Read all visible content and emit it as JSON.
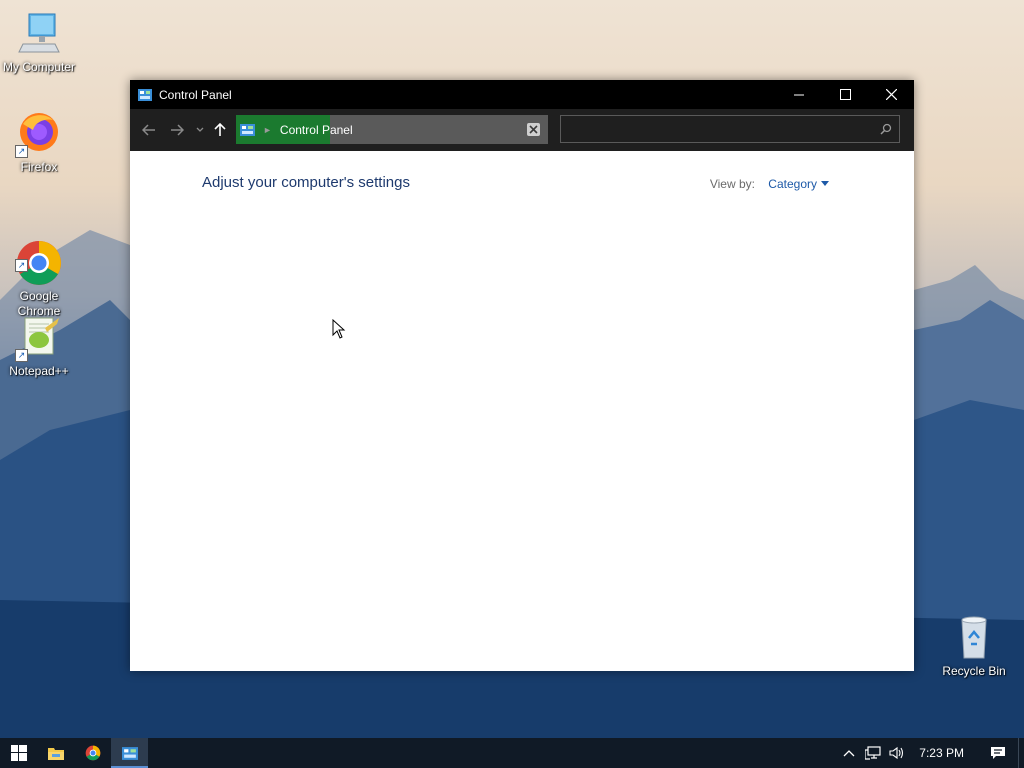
{
  "desktop": {
    "icons": [
      {
        "label": "My Computer",
        "icon": "computer-icon"
      },
      {
        "label": "Firefox",
        "icon": "firefox-icon"
      },
      {
        "label": "Google\nChrome",
        "icon": "chrome-icon"
      },
      {
        "label": "Notepad++",
        "icon": "notepadpp-icon"
      },
      {
        "label": "Recycle Bin",
        "icon": "recycle-bin-icon"
      }
    ]
  },
  "window": {
    "title": "Control Panel",
    "address": {
      "crumb": "Control Panel",
      "search_placeholder": ""
    },
    "content": {
      "heading": "Adjust your computer's settings",
      "view_by_label": "View by:",
      "view_by_value": "Category"
    }
  },
  "taskbar": {
    "items": [
      "start-icon",
      "file-explorer-icon",
      "chrome-icon",
      "control-panel-icon"
    ],
    "active": "control-panel-icon",
    "clock": "7:23 PM"
  },
  "colors": {
    "accent": "#1e5aa8",
    "heading": "#1e3a6e",
    "address_highlight": "#1b7a2f",
    "titlebar": "#000000",
    "taskbar": "#101a26"
  }
}
